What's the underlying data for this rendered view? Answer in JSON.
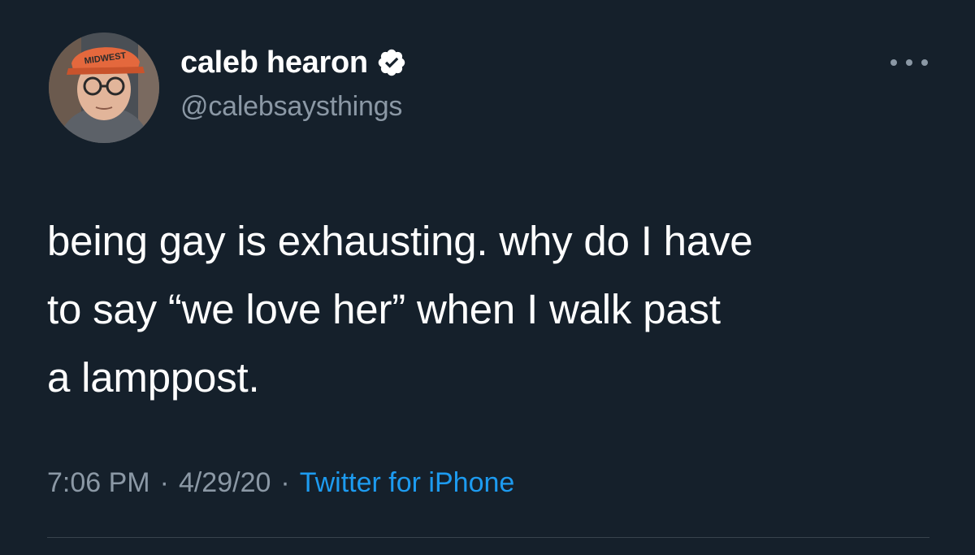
{
  "author": {
    "display_name": "caleb hearon",
    "handle": "@calebsaysthings",
    "verified": true,
    "verified_icon": "verified-badge-icon",
    "hat_text": "MIDWEST"
  },
  "menu": {
    "icon": "more-options-icon"
  },
  "tweet": {
    "lines": [
      "being gay is exhausting. why do I have",
      "to say “we love her” when I walk past",
      "a lamppost."
    ]
  },
  "meta": {
    "time": "7:06 PM",
    "separator": "·",
    "date": "4/29/20",
    "source": "Twitter for iPhone"
  },
  "colors": {
    "background": "#15202b",
    "text_primary": "#ffffff",
    "text_secondary": "#8b98a5",
    "accent": "#1d9bf0",
    "divider": "#38444d"
  }
}
